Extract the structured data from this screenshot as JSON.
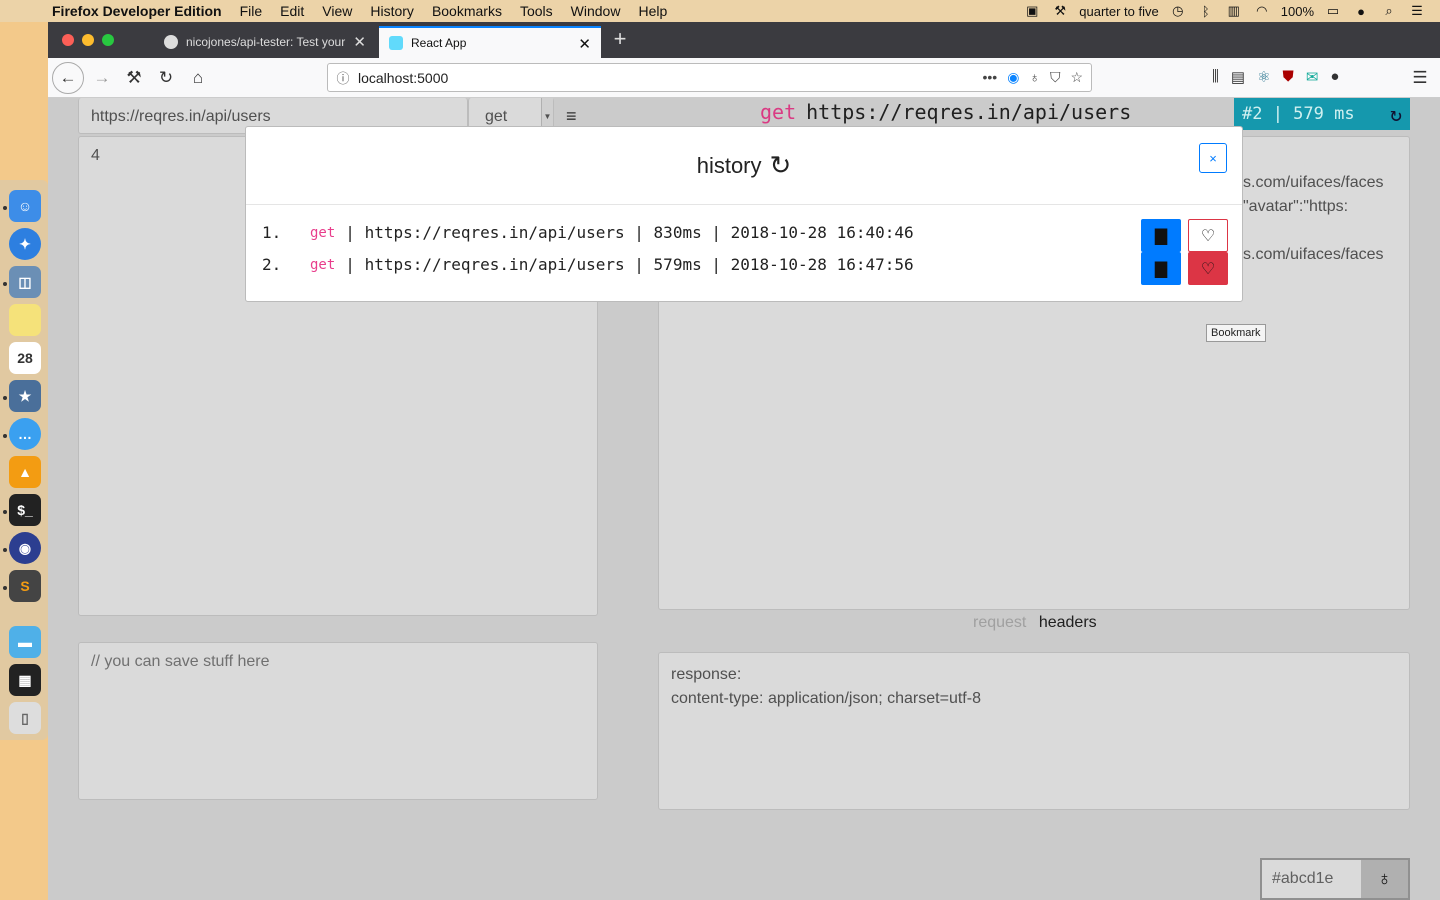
{
  "menubar": {
    "app_name": "Firefox Developer Edition",
    "menus": [
      "File",
      "Edit",
      "View",
      "History",
      "Bookmarks",
      "Tools",
      "Window",
      "Help"
    ],
    "clock_text": "quarter to five",
    "battery": "100%"
  },
  "browser": {
    "tabs": [
      {
        "title": "nicojones/api-tester: Test your"
      },
      {
        "title": "React App"
      }
    ],
    "url": "localhost:5000"
  },
  "app": {
    "request_url": "https://reqres.in/api/users",
    "method": "get",
    "request_body": "4",
    "notes_placeholder": "// you can save stuff here",
    "response_line": {
      "method": "get",
      "url": "https://reqres.in/api/users"
    },
    "stats": "#2 | 579 ms",
    "response_fragments": [
      "s.com/uifaces/faces",
      "\"avatar\":\"https:",
      "s.com/uifaces/faces"
    ],
    "response_tabs": {
      "inactive": "request",
      "active": "headers"
    },
    "response_headers": [
      "response:",
      "content-type: application/json; charset=utf-8"
    ],
    "theme_color": "#abcd1e"
  },
  "history_modal": {
    "title": "history",
    "close_label": "×",
    "entries": [
      {
        "index": "1.",
        "method": "get",
        "details": "| https://reqres.in/api/users | 830ms | 2018-10-28 16:40:46",
        "favorite": false
      },
      {
        "index": "2.",
        "method": "get",
        "details": "| https://reqres.in/api/users | 579ms | 2018-10-28 16:47:56",
        "favorite": true
      }
    ],
    "tooltip": "Bookmark"
  },
  "colors": {
    "accent": "#007bff",
    "danger": "#dc3545",
    "info": "#17a2b8",
    "method_pink": "#e83e8c"
  }
}
